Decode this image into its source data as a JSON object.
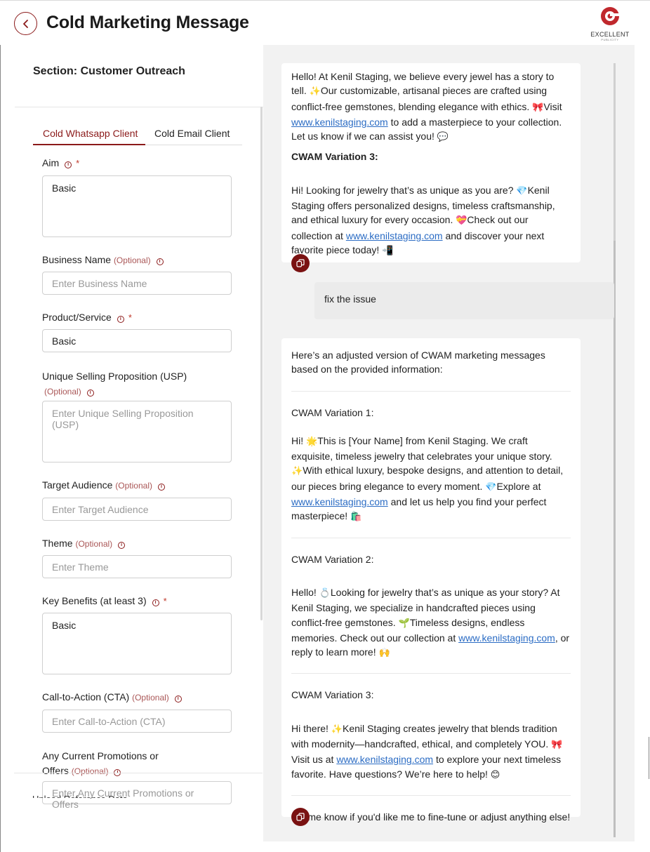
{
  "header": {
    "title": "Cold Marketing Message",
    "logo_text": "EXCELLENT",
    "logo_sub": "PUBLICITY"
  },
  "left": {
    "section_title": "Section: Customer Outreach",
    "tabs": [
      {
        "label": "Cold Whatsapp Client",
        "active": true
      },
      {
        "label": "Cold Email Client",
        "active": false
      }
    ],
    "optional_text": "(Optional)",
    "fields": {
      "aim": {
        "label": "Aim",
        "value": "Basic"
      },
      "business_name": {
        "label": "Business Name",
        "placeholder": "Enter Business Name"
      },
      "product": {
        "label": "Product/Service",
        "value": "Basic"
      },
      "usp": {
        "label": "Unique Selling Proposition (USP)",
        "placeholder": "Enter Unique Selling Proposition (USP)"
      },
      "audience": {
        "label": "Target Audience",
        "placeholder": "Enter Target Audience"
      },
      "theme": {
        "label": "Theme",
        "placeholder": "Enter Theme"
      },
      "benefits": {
        "label": "Key Benefits (at least 3)",
        "value": "Basic"
      },
      "cta": {
        "label": "Call-to-Action (CTA)",
        "placeholder": "Enter Call-to-Action (CTA)"
      },
      "promotions": {
        "label_line1": "Any Current Promotions or",
        "label_line2": "Offers",
        "placeholder": "Enter Any Current Promotions or Offers"
      }
    },
    "cutoff_label": "Upload Reference Data"
  },
  "chat": {
    "msg1": {
      "intro_a": "Hello! At Kenil Staging, we believe every jewel has a story to tell. ",
      "intro_b": "Our customizable, artisanal pieces are crafted using conflict-free gemstones, blending elegance with ethics. ",
      "intro_c": "Visit ",
      "link": "www.kenilstaging.com",
      "intro_d": " to add a masterpiece to your collection. Let us know if we can assist you! ",
      "var_title": "CWAM Variation 3:",
      "v3_a": "Hi! Looking for jewelry that’s as unique as you are? ",
      "v3_b": "Kenil Staging offers personalized designs, timeless craftsmanship, and ethical luxury for every occasion. ",
      "v3_c": "Check out our collection at ",
      "v3_d": " and discover your next favorite piece today! "
    },
    "user_msg": "fix the issue",
    "msg2": {
      "intro": "Here’s an adjusted version of CWAM marketing messages based on the provided information:",
      "v1_title": "CWAM Variation 1:",
      "v1_a": "Hi! ",
      "v1_b": "This is [Your Name] from Kenil Staging. We craft exquisite, timeless jewelry that celebrates your unique story. ",
      "v1_c": "With ethical luxury, bespoke designs, and attention to detail, our pieces bring elegance to every moment. ",
      "v1_d": "Explore at ",
      "v1_e": " and let us help you find your perfect masterpiece! ",
      "v2_title": "CWAM Variation 2:",
      "v2_a": "Hello! ",
      "v2_b": "Looking for jewelry that’s as unique as your story? At Kenil Staging, we specialize in handcrafted pieces using conflict-free gemstones. ",
      "v2_c": "Timeless designs, endless memories. Check out our collection at ",
      "v2_d": ", or reply to learn more! ",
      "v3_title": "CWAM Variation 3:",
      "v3_a": "Hi there! ",
      "v3_b": "Kenil Staging creates jewelry that blends tradition with modernity—handcrafted, ethical, and completely YOU. ",
      "v3_c": "Visit us at ",
      "v3_d": " to explore your next timeless favorite. Have questions? We’re here to help! ",
      "closing": "Let me know if you'd like me to fine-tune or adjust anything else!",
      "link": "www.kenilstaging.com"
    },
    "emoji": {
      "sparkles": "✨",
      "bow": "🎀",
      "speech": "💬",
      "gem": "💎",
      "heart": "💝",
      "phone": "📲",
      "glowing_star": "🌟",
      "shopping": "🛍️",
      "ring": "💍",
      "seedling": "🌱",
      "raised_hands": "🙌",
      "smile": "😊"
    }
  }
}
